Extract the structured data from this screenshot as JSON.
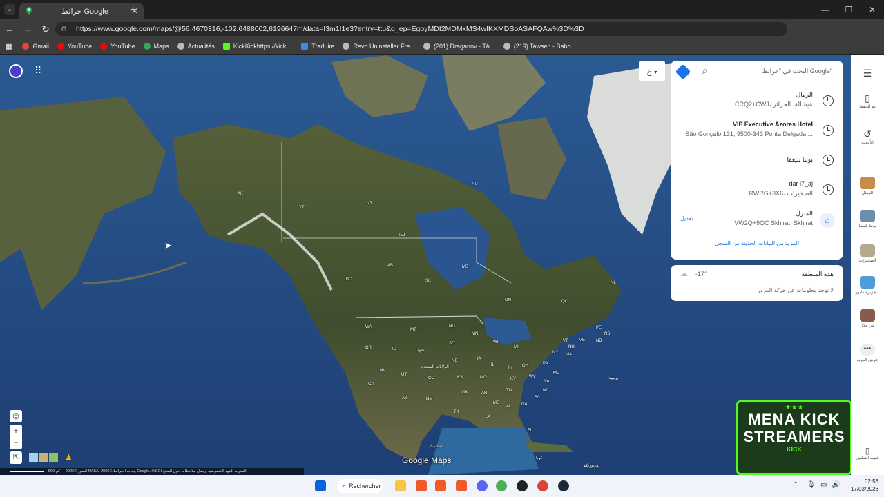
{
  "browser": {
    "tab_title": "خرائط Google",
    "url": "https://www.google.com/maps/@56.4670316,-102.6488002,6196647m/data=!3m1!1e3?entry=ttu&g_ep=EgoyMDI2MDMxMS4wIKXMDSoASAFQAw%3D%3D",
    "extension_badge": "539",
    "bookmarks": [
      "Gmail",
      "YouTube",
      "YouTube",
      "Maps",
      "Actualités",
      "KickKickhttps://kick....",
      "Traduire",
      "Revo Uninstaller Fre...",
      "(201) Draganov - TA...",
      "(219) Tawsen - Babo..."
    ]
  },
  "search": {
    "placeholder": "البحث في \"خرائط Google\""
  },
  "recent": [
    {
      "name": "الرمال",
      "address": "CRQ2+CWJ، عيشالة، الجزائر"
    },
    {
      "name": "VIP Executive Azores Hotel",
      "address": "São Gonçalo 131, 9500-343 Ponta Delgada ..."
    },
    {
      "name": "بوتنا بليغفا",
      "address": ""
    },
    {
      "name": "dar l7_aj",
      "address": "RWRG+3X6، الصخيرات"
    }
  ],
  "home": {
    "name": "المنزل",
    "address": "VW2Q+9QC Skhirat, Skhirat",
    "edit": "تعديل"
  },
  "more_history": "المزيد من البيانات الحديثة من السجل",
  "weather": {
    "title": "هذه المنطقة",
    "temp": "-17°",
    "traffic": "لا توجد معلومات عن حركة المرور"
  },
  "lang_btn": "ع",
  "rail": {
    "menu": "menu",
    "saved": "تم الحفظ",
    "recents": "الأحدث",
    "items": [
      "الرمال",
      "بوتنا بليغفا",
      "الصخيرات",
      "جزيرة مايور...",
      "بني ملال"
    ],
    "more": "عرض المزيد",
    "install": "تثبيت التطبيق"
  },
  "map_labels": {
    "AK": "AK",
    "YT": "YT",
    "NT": "NT",
    "NU": "NU",
    "BC": "BC",
    "AB": "AB",
    "SK": "SK",
    "MB": "MB",
    "ON": "ON",
    "QC": "QC",
    "NL": "NL",
    "NB": "NB",
    "NS": "NS",
    "PE": "PE",
    "WA": "WA",
    "OR": "OR",
    "CA": "CA",
    "NV": "NV",
    "ID": "ID",
    "MT": "MT",
    "WY": "WY",
    "UT": "UT",
    "AZ": "AZ",
    "CO": "CO",
    "NM": "NM",
    "ND": "ND",
    "SD": "SD",
    "NE": "NE",
    "KS": "KS",
    "OK": "OK",
    "TX": "TX",
    "MN": "MN",
    "IA": "IA",
    "MO": "MO",
    "AR": "AR",
    "LA": "LA",
    "WI": "WI",
    "IL": "IL",
    "MS": "MS",
    "MI": "MI",
    "IN": "IN",
    "KY": "KY",
    "TN": "TN",
    "AL": "AL",
    "GA": "GA",
    "FL": "FL",
    "OH": "OH",
    "WV": "WV",
    "VA": "VA",
    "NC": "NC",
    "SC": "SC",
    "PA": "PA",
    "NY": "NY",
    "ME": "ME",
    "VT": "VT",
    "NH": "NH",
    "MA": "MA",
    "MD": "MD",
    "canada": "كندا",
    "usa": "الولايات المتحدة",
    "mexico": "المكسيك",
    "cuba": "كوبا",
    "puerto": "بورتوريكو",
    "bermuda": "برمودا"
  },
  "google_maps": "Google Maps",
  "attribution": "الصور ©2026 NASA، بيانات الخرائط ©2026 Google، INEGI   المغرب   البنود   الخصوصية   إرسال ملاحظات حول المنتج",
  "scale": "500 كم",
  "logo": {
    "line1": "MENA KICK",
    "line2": "STREAMERS",
    "brand": "KICK"
  },
  "taskbar": {
    "search": "Rechercher",
    "time": "02:56",
    "date": "17/03/2026"
  }
}
